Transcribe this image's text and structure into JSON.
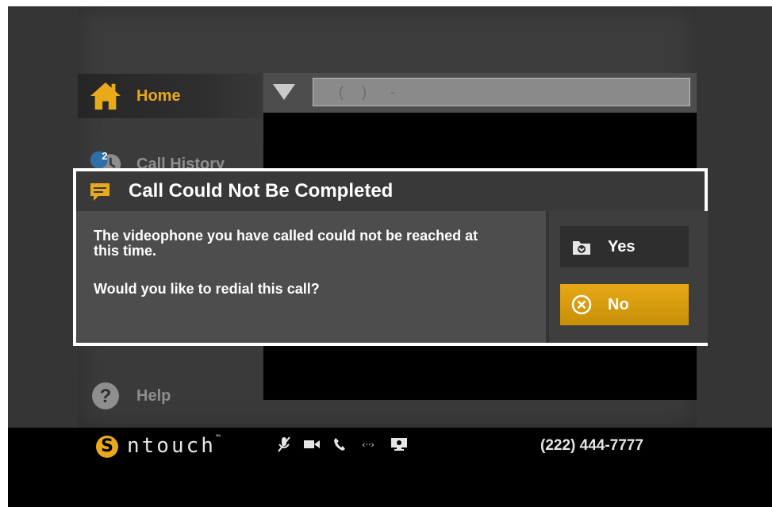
{
  "sidebar": {
    "items": [
      {
        "label": "Home",
        "active": true
      },
      {
        "label": "Call History",
        "badge": "2"
      },
      {
        "label": "Help"
      }
    ]
  },
  "dialer": {
    "number_mask": "  (   )    -"
  },
  "dialog": {
    "title": "Call Could Not Be Completed",
    "message": "The videophone you have called could not be reached at this time.",
    "question": "Would you like to redial this call?",
    "yes_label": "Yes",
    "no_label": "No"
  },
  "statusbar": {
    "brand": "ntouch",
    "brand_mark": "S",
    "trademark": "™",
    "phone_number": "(222) 444-7777",
    "icons": [
      "mic-muted-icon",
      "video-camera-icon",
      "phone-icon",
      "network-icon",
      "monitor-icon"
    ]
  },
  "colors": {
    "accent": "#e8a91a",
    "background": "#333333",
    "video": "#000000",
    "modal_border": "#ffffff"
  }
}
